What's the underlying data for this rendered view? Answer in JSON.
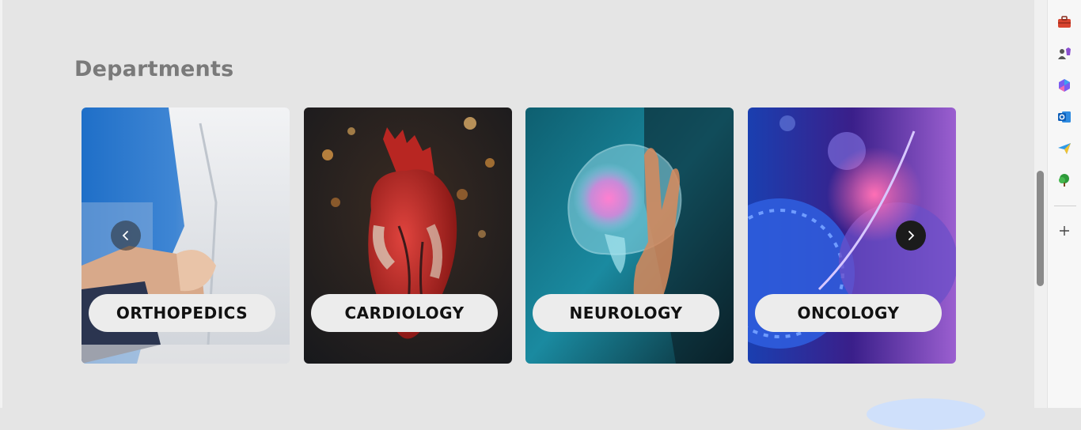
{
  "section": {
    "title": "Departments"
  },
  "departments": [
    {
      "label": "ORTHOPEDICS"
    },
    {
      "label": "CARDIOLOGY"
    },
    {
      "label": "NEUROLOGY"
    },
    {
      "label": "ONCOLOGY"
    }
  ],
  "carousel": {
    "prev_icon": "chevron-left-icon",
    "next_icon": "chevron-right-icon"
  },
  "sidebar": {
    "icons": [
      "toolbox-icon",
      "games-icon",
      "copilot-icon",
      "outlook-icon",
      "send-icon",
      "tree-icon",
      "add-icon"
    ]
  },
  "colors": {
    "page_bg": "#e5e5e5",
    "title": "#7a7a7a",
    "label_pill": "#ececec",
    "label_text": "#111111",
    "next_button": "#1b1b1b"
  }
}
